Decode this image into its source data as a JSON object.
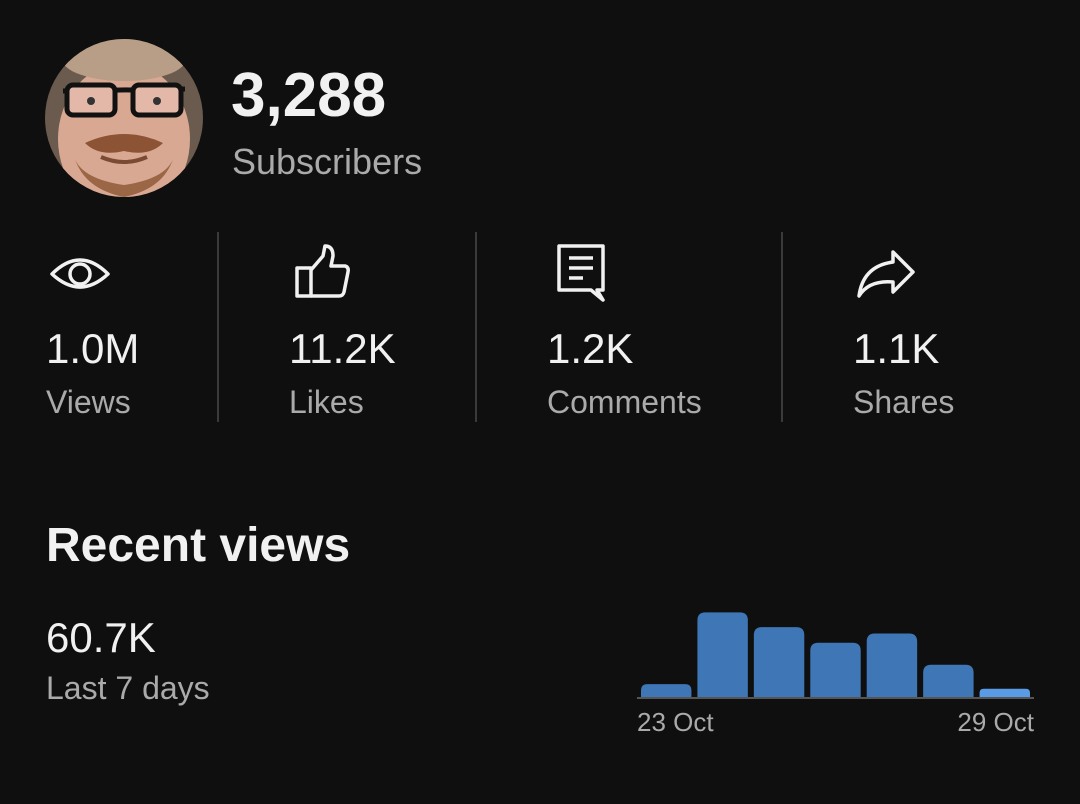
{
  "channel": {
    "subscriber_count": "3,288",
    "subscriber_label": "Subscribers"
  },
  "stats": [
    {
      "icon": "eye-icon",
      "value": "1.0M",
      "label": "Views"
    },
    {
      "icon": "thumbs-up-icon",
      "value": "11.2K",
      "label": "Likes"
    },
    {
      "icon": "comment-icon",
      "value": "1.2K",
      "label": "Comments"
    },
    {
      "icon": "share-icon",
      "value": "1.1K",
      "label": "Shares"
    }
  ],
  "recent": {
    "title": "Recent views",
    "value": "60.7K",
    "period": "Last 7 days"
  },
  "colors": {
    "background": "#0f0f0f",
    "bar": "#3f76b5",
    "bar_highlight": "#5a9be6",
    "text_primary": "#f1f1f1",
    "text_secondary": "#aaaaaa"
  },
  "chart_data": {
    "type": "bar",
    "categories": [
      "",
      "",
      "",
      "",
      "",
      "",
      ""
    ],
    "values": [
      14,
      92,
      76,
      59,
      69,
      35,
      9
    ],
    "highlight_index": 6,
    "x_tick_labels": {
      "first": "23 Oct",
      "last": "29 Oct"
    },
    "title": "",
    "xlabel": "",
    "ylabel": "",
    "ylim": [
      0,
      100
    ],
    "grid": false
  }
}
